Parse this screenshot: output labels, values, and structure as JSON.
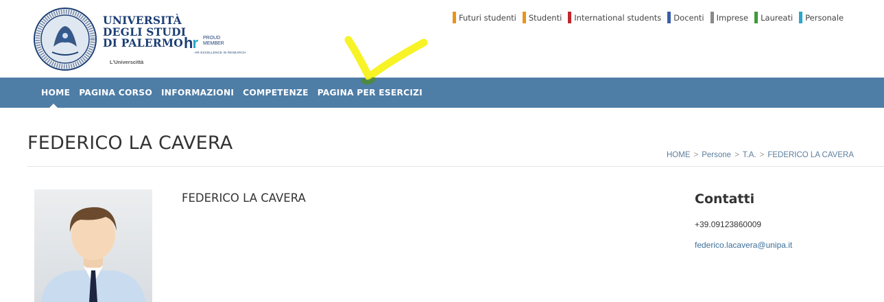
{
  "header": {
    "university_name_lines": [
      "UNIVERSITÀ",
      "DEGLI STUDI",
      "DI PALERMO"
    ],
    "university_tagline": "L'Universcittà",
    "hr_badge": {
      "mark": "hr",
      "text_line1": "PROUD",
      "text_line2": "MEMBER",
      "tagline": "HR EXCELLENCE IN RESEARCH"
    }
  },
  "audience_links": [
    {
      "label": "Futuri studenti",
      "color": "#e8941a"
    },
    {
      "label": "Studenti",
      "color": "#e8941a"
    },
    {
      "label": "International students",
      "color": "#c0282d"
    },
    {
      "label": "Docenti",
      "color": "#3a5ea8"
    },
    {
      "label": "Imprese",
      "color": "#8a8a8a"
    },
    {
      "label": "Laureati",
      "color": "#3f9a3b"
    },
    {
      "label": "Personale",
      "color": "#2aa6c9"
    }
  ],
  "nav": {
    "items": [
      {
        "label": "HOME"
      },
      {
        "label": "PAGINA CORSO"
      },
      {
        "label": "INFORMAZIONI"
      },
      {
        "label": "COMPETENZE"
      },
      {
        "label": "PAGINA PER ESERCIZI"
      }
    ],
    "active_index": 0,
    "background": "#4e7da6"
  },
  "page": {
    "title": "FEDERICO LA CAVERA",
    "breadcrumb": [
      "HOME",
      "Persone",
      "T.A.",
      "FEDERICO LA CAVERA"
    ],
    "breadcrumb_separator": ">"
  },
  "profile": {
    "name": "FEDERICO LA CAVERA"
  },
  "contacts": {
    "title": "Contatti",
    "phone": "+39.09123860009",
    "email": "federico.lacavera@unipa.it"
  },
  "annotation": {
    "color": "#ffff00",
    "shape": "checkmark"
  }
}
